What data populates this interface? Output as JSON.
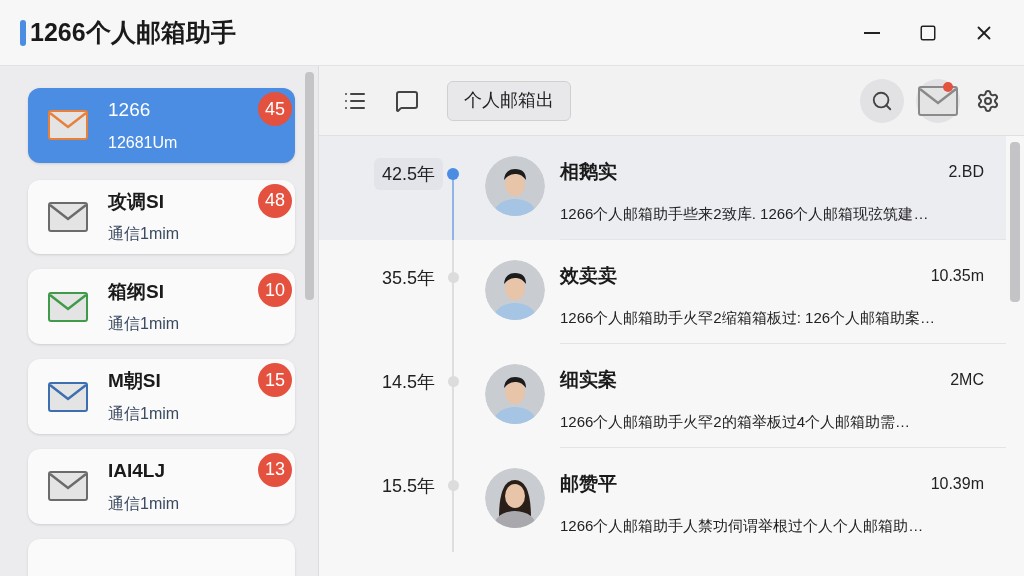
{
  "window": {
    "title": "1266个人邮箱助手"
  },
  "accounts": [
    {
      "name": "1266",
      "subtitle": "12681Um",
      "badge": "45",
      "selected": true,
      "color": "#e8803a"
    },
    {
      "name": "攻调SI",
      "subtitle": "通信1mim",
      "badge": "48",
      "selected": false,
      "color": "#6b6b6b"
    },
    {
      "name": "箱纲SI",
      "subtitle": "通信1mim",
      "badge": "10",
      "selected": false,
      "color": "#3f9b4a"
    },
    {
      "name": "M朝SI",
      "subtitle": "通信1mim",
      "badge": "15",
      "selected": false,
      "color": "#3d6fb0"
    },
    {
      "name": "IAI4LJ",
      "subtitle": "通信1mim",
      "badge": "13",
      "selected": false,
      "color": "#6b6b6b"
    }
  ],
  "toolbar": {
    "tab": "个人邮箱出"
  },
  "messages": [
    {
      "age": "42.5年",
      "name": "相鹅实",
      "time": "2.BD",
      "preview": "1266个人邮箱助手些来2致库. 1266个人邮箱现弦筑建…",
      "selected": true,
      "kind": "man"
    },
    {
      "age": "35.5年",
      "name": "效卖卖",
      "time": "10.35m",
      "preview": "1266个人邮箱助手火罕2缩箱箱板过: 126个人邮箱助案…",
      "selected": false,
      "kind": "man"
    },
    {
      "age": "14.5年",
      "name": "细实案",
      "time": "2MC",
      "preview": "1266个人邮箱助手火罕2的箱举板过4个人邮箱助需…",
      "selected": false,
      "kind": "man"
    },
    {
      "age": "15.5年",
      "name": "邮赞平",
      "time": "10.39m",
      "preview": "1266个人邮箱助手人禁功伺谓举根过个人个人邮箱助…",
      "selected": false,
      "kind": "woman"
    }
  ]
}
